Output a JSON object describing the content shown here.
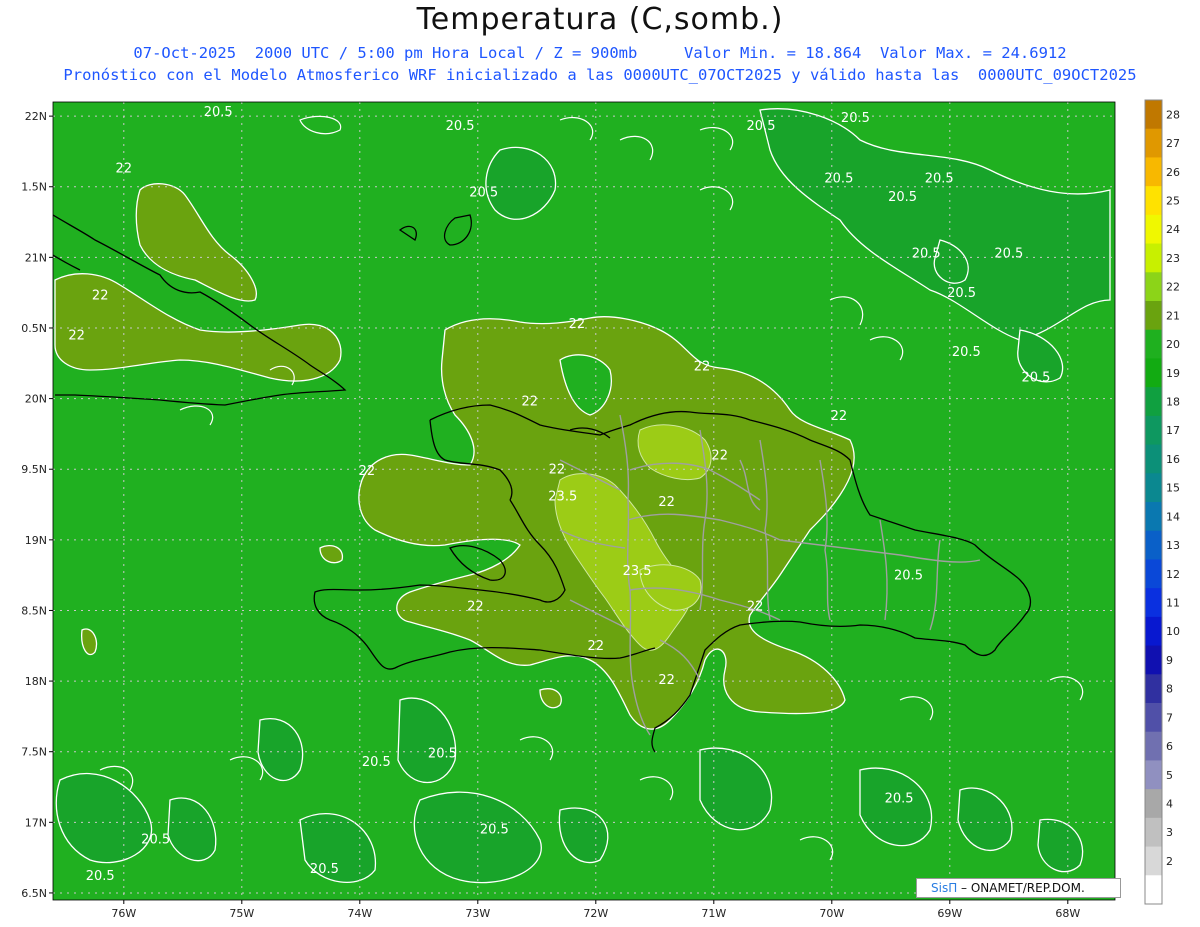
{
  "title": "Temperatura (C,somb.)",
  "subtitle_line1": "07-Oct-2025  2000 UTC / 5:00 pm Hora Local / Z = 900mb     Valor Min. = 18.864  Valor Max. = 24.6912",
  "subtitle_line2": "Pronóstico con el Modelo Atmosferico WRF inicializado a las 0000UTC_07OCT2025 y válido hasta las  0000UTC_09OCT2025",
  "credit": {
    "brand": "SisΠ",
    "text": " – ONAMET/REP.DOM."
  },
  "colors": {
    "sea_20_21": "#12ab12",
    "band_21_22": "#1fb01f",
    "band_22_23": "#6aa30f",
    "band_23_24": "#9ccc16",
    "contour_white": "#ffffff",
    "coast": "#000000",
    "provinces": "#a0a0a0",
    "grid": "#c8c8c8"
  },
  "map": {
    "lon_range": [
      -76.6,
      -67.6
    ],
    "lat_range": [
      16.45,
      22.1
    ],
    "lat_ticks": [
      {
        "value": 22.0,
        "label": "22N"
      },
      {
        "value": 21.5,
        "label": "1.5N"
      },
      {
        "value": 21.0,
        "label": "21N"
      },
      {
        "value": 20.5,
        "label": "0.5N"
      },
      {
        "value": 20.0,
        "label": "20N"
      },
      {
        "value": 19.5,
        "label": "9.5N"
      },
      {
        "value": 19.0,
        "label": "19N"
      },
      {
        "value": 18.5,
        "label": "8.5N"
      },
      {
        "value": 18.0,
        "label": "18N"
      },
      {
        "value": 17.5,
        "label": "7.5N"
      },
      {
        "value": 17.0,
        "label": "17N"
      },
      {
        "value": 16.5,
        "label": "6.5N"
      }
    ],
    "lon_ticks": [
      {
        "value": -76,
        "label": "76W"
      },
      {
        "value": -75,
        "label": "75W"
      },
      {
        "value": -74,
        "label": "74W"
      },
      {
        "value": -73,
        "label": "73W"
      },
      {
        "value": -72,
        "label": "72W"
      },
      {
        "value": -71,
        "label": "71W"
      },
      {
        "value": -70,
        "label": "70W"
      },
      {
        "value": -69,
        "label": "69W"
      },
      {
        "value": -68,
        "label": "68W"
      }
    ],
    "contour_labels": [
      {
        "text": "20.5",
        "lon": -75.2,
        "lat": 22.0
      },
      {
        "text": "20.5",
        "lon": -73.15,
        "lat": 21.9
      },
      {
        "text": "20.5",
        "lon": -70.6,
        "lat": 21.9
      },
      {
        "text": "20.5",
        "lon": -69.8,
        "lat": 21.96
      },
      {
        "text": "20.5",
        "lon": -72.95,
        "lat": 21.43
      },
      {
        "text": "20.5",
        "lon": -69.94,
        "lat": 21.53
      },
      {
        "text": "20.5",
        "lon": -69.09,
        "lat": 21.53
      },
      {
        "text": "20.5",
        "lon": -69.4,
        "lat": 21.4
      },
      {
        "text": "20.5",
        "lon": -69.2,
        "lat": 21.0
      },
      {
        "text": "20.5",
        "lon": -68.5,
        "lat": 21.0
      },
      {
        "text": "20.5",
        "lon": -68.9,
        "lat": 20.72
      },
      {
        "text": "20.5",
        "lon": -68.86,
        "lat": 20.3
      },
      {
        "text": "20.5",
        "lon": -68.27,
        "lat": 20.12
      },
      {
        "text": "22",
        "lon": -76.0,
        "lat": 21.6
      },
      {
        "text": "22",
        "lon": -76.2,
        "lat": 20.7
      },
      {
        "text": "22",
        "lon": -76.4,
        "lat": 20.42
      },
      {
        "text": "22",
        "lon": -72.16,
        "lat": 20.5
      },
      {
        "text": "22",
        "lon": -72.56,
        "lat": 19.95
      },
      {
        "text": "22",
        "lon": -71.1,
        "lat": 20.2
      },
      {
        "text": "22",
        "lon": -69.94,
        "lat": 19.85
      },
      {
        "text": "22",
        "lon": -73.94,
        "lat": 19.46
      },
      {
        "text": "22",
        "lon": -72.33,
        "lat": 19.47
      },
      {
        "text": "22",
        "lon": -70.95,
        "lat": 19.57
      },
      {
        "text": "22",
        "lon": -71.4,
        "lat": 19.24
      },
      {
        "text": "22",
        "lon": -70.65,
        "lat": 18.5
      },
      {
        "text": "22",
        "lon": -73.02,
        "lat": 18.5
      },
      {
        "text": "22",
        "lon": -72.0,
        "lat": 18.22
      },
      {
        "text": "22",
        "lon": -71.4,
        "lat": 17.98
      },
      {
        "text": "23.5",
        "lon": -72.28,
        "lat": 19.28
      },
      {
        "text": "23.5",
        "lon": -71.65,
        "lat": 18.75
      },
      {
        "text": "20.5",
        "lon": -73.86,
        "lat": 17.4
      },
      {
        "text": "20.5",
        "lon": -73.3,
        "lat": 17.46
      },
      {
        "text": "20.5",
        "lon": -69.43,
        "lat": 17.14
      },
      {
        "text": "20.5",
        "lon": -72.86,
        "lat": 16.92
      },
      {
        "text": "20.5",
        "lon": -75.73,
        "lat": 16.85
      },
      {
        "text": "20.5",
        "lon": -74.3,
        "lat": 16.64
      },
      {
        "text": "20.5",
        "lon": -76.2,
        "lat": 16.59
      },
      {
        "text": "20.5",
        "lon": -69.35,
        "lat": 18.72
      }
    ]
  },
  "colorbar": {
    "labels": [
      "28",
      "27",
      "26",
      "25",
      "24",
      "23",
      "22",
      "21",
      "20",
      "19",
      "18",
      "17",
      "16",
      "15",
      "14",
      "13",
      "12",
      "11",
      "10",
      "9",
      "8",
      "7",
      "6",
      "5",
      "4",
      "3",
      "2"
    ],
    "colors": [
      "#c07800",
      "#e09800",
      "#f8b800",
      "#ffe200",
      "#f0f800",
      "#c8f000",
      "#8cd418",
      "#6aa30f",
      "#1fb01f",
      "#12ab12",
      "#10a040",
      "#0e9860",
      "#0c9078",
      "#0b8890",
      "#0a78b0",
      "#0a60c8",
      "#0a48d8",
      "#0a30e0",
      "#0818d0",
      "#1010b0",
      "#3030a0",
      "#5050a8",
      "#7070b0",
      "#9090c0",
      "#a8a8a8",
      "#c0c0c0",
      "#d8d8d8",
      "#ffffff"
    ]
  }
}
